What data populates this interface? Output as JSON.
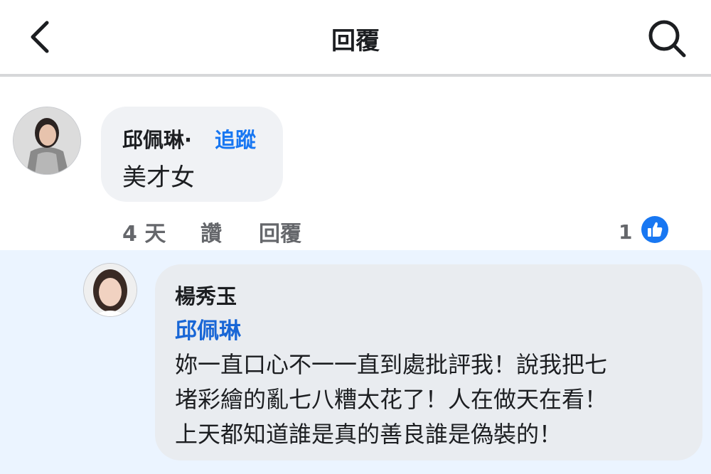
{
  "header": {
    "title": "回覆"
  },
  "comment": {
    "author": "邱佩琳",
    "separator": "·",
    "follow": "追蹤",
    "text": "美才女",
    "time": "4 天",
    "like_action": "讚",
    "reply_action": "回覆",
    "reaction_count": "1",
    "reaction_icon": "thumbs-up-icon"
  },
  "reply": {
    "author": "楊秀玉",
    "mention": "邱佩琳",
    "lines": [
      "妳一直口心不一一直到處批評我！說我把七",
      "堵彩繪的亂七八糟太花了！人在做天在看！",
      "上天都知道誰是真的善良誰是偽裝的！"
    ]
  },
  "colors": {
    "accent": "#1877f2",
    "reply_background": "#ebf4ff",
    "bubble": "#f0f2f5"
  }
}
